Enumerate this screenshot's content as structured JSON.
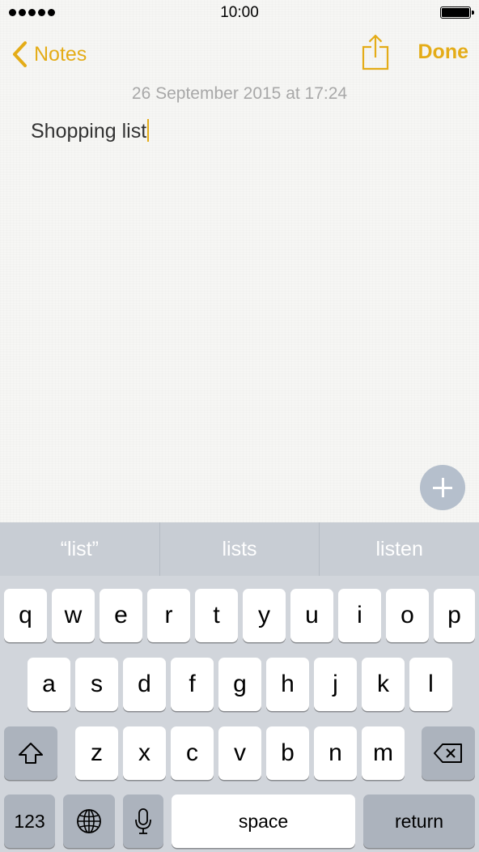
{
  "status_bar": {
    "time": "10:00",
    "signal_dots": 5,
    "battery_level": 1.0
  },
  "nav": {
    "back_label": "Notes",
    "done_label": "Done",
    "accent_color": "#e4ac17"
  },
  "note": {
    "timestamp": "26 September 2015 at 17:24",
    "text": "Shopping list"
  },
  "predictions": [
    "“list”",
    "lists",
    "listen"
  ],
  "keyboard": {
    "row1": [
      "q",
      "w",
      "e",
      "r",
      "t",
      "y",
      "u",
      "i",
      "o",
      "p"
    ],
    "row2": [
      "a",
      "s",
      "d",
      "f",
      "g",
      "h",
      "j",
      "k",
      "l"
    ],
    "row3": [
      "z",
      "x",
      "c",
      "v",
      "b",
      "n",
      "m"
    ],
    "numbers_label": "123",
    "space_label": "space",
    "return_label": "return"
  },
  "icons": {
    "back": "chevron-left-icon",
    "share": "share-icon",
    "add": "plus-icon",
    "shift": "shift-icon",
    "delete": "delete-icon",
    "globe": "globe-icon",
    "mic": "microphone-icon"
  }
}
